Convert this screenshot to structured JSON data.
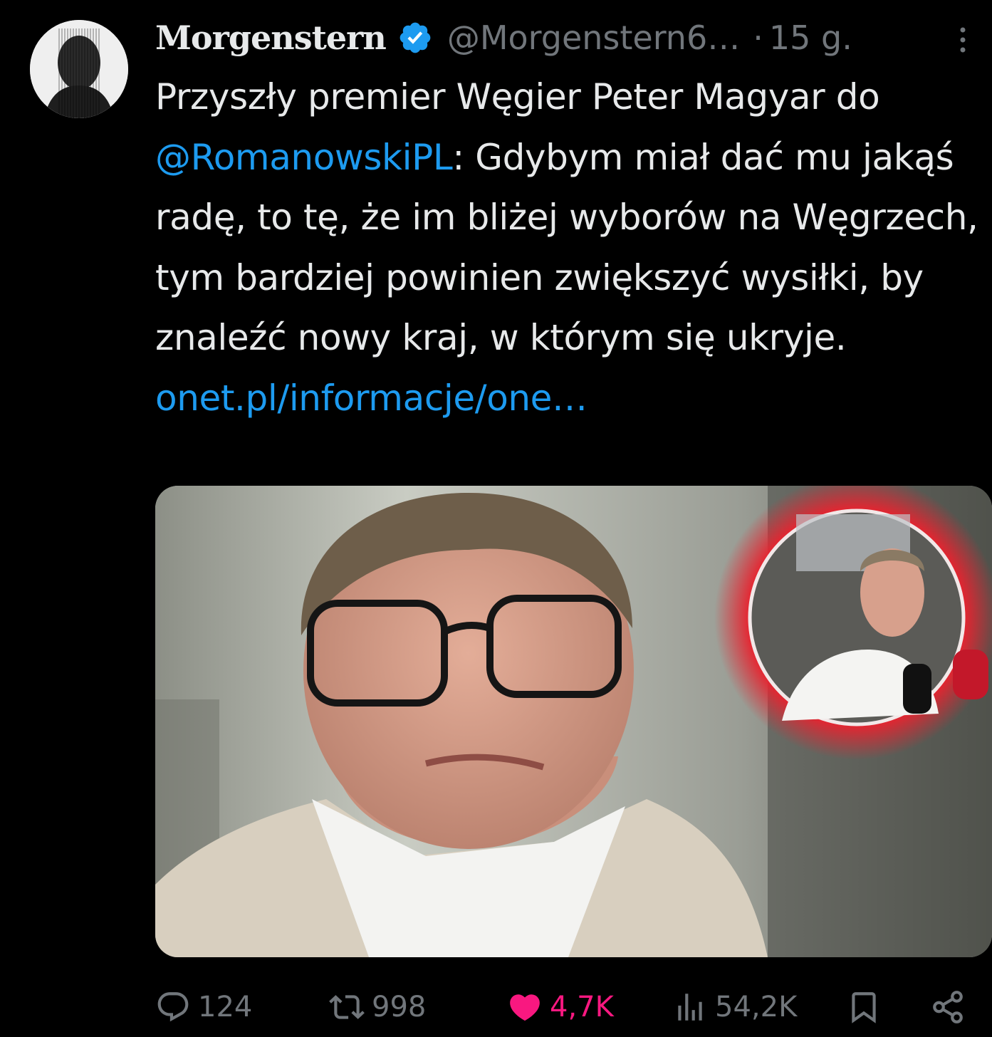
{
  "author": {
    "display_name": "Morgenstern",
    "handle": "@Morgenstern6…",
    "separator": "·",
    "time": "15 g.",
    "verified": true
  },
  "tweet": {
    "text_1": "Przyszły premier Węgier Peter Magyar do ",
    "mention": "@RomanowskiPL",
    "text_2": ": Gdybym miał dać mu jakąś radę, to tę, że im bliżej wyborów na Węgrzech, tym bardziej powinien zwiększyć wysiłki, by znaleźć nowy kraj, w którym się ukryje. ",
    "link": "onet.pl/informacje/one…"
  },
  "actions": {
    "replies": "124",
    "retweets": "998",
    "likes": "4,7K",
    "views": "54,2K"
  },
  "icons": {
    "more": "more-vertical-icon",
    "verified": "verified-badge-icon",
    "reply": "reply-icon",
    "retweet": "retweet-icon",
    "like": "heart-icon",
    "views": "views-icon",
    "bookmark": "bookmark-icon",
    "share": "share-icon"
  },
  "colors": {
    "background": "#000000",
    "text": "#e7e9ea",
    "secondary": "#71767b",
    "link": "#1d9bf0",
    "like": "#f91880",
    "verified": "#1d9bf0"
  }
}
